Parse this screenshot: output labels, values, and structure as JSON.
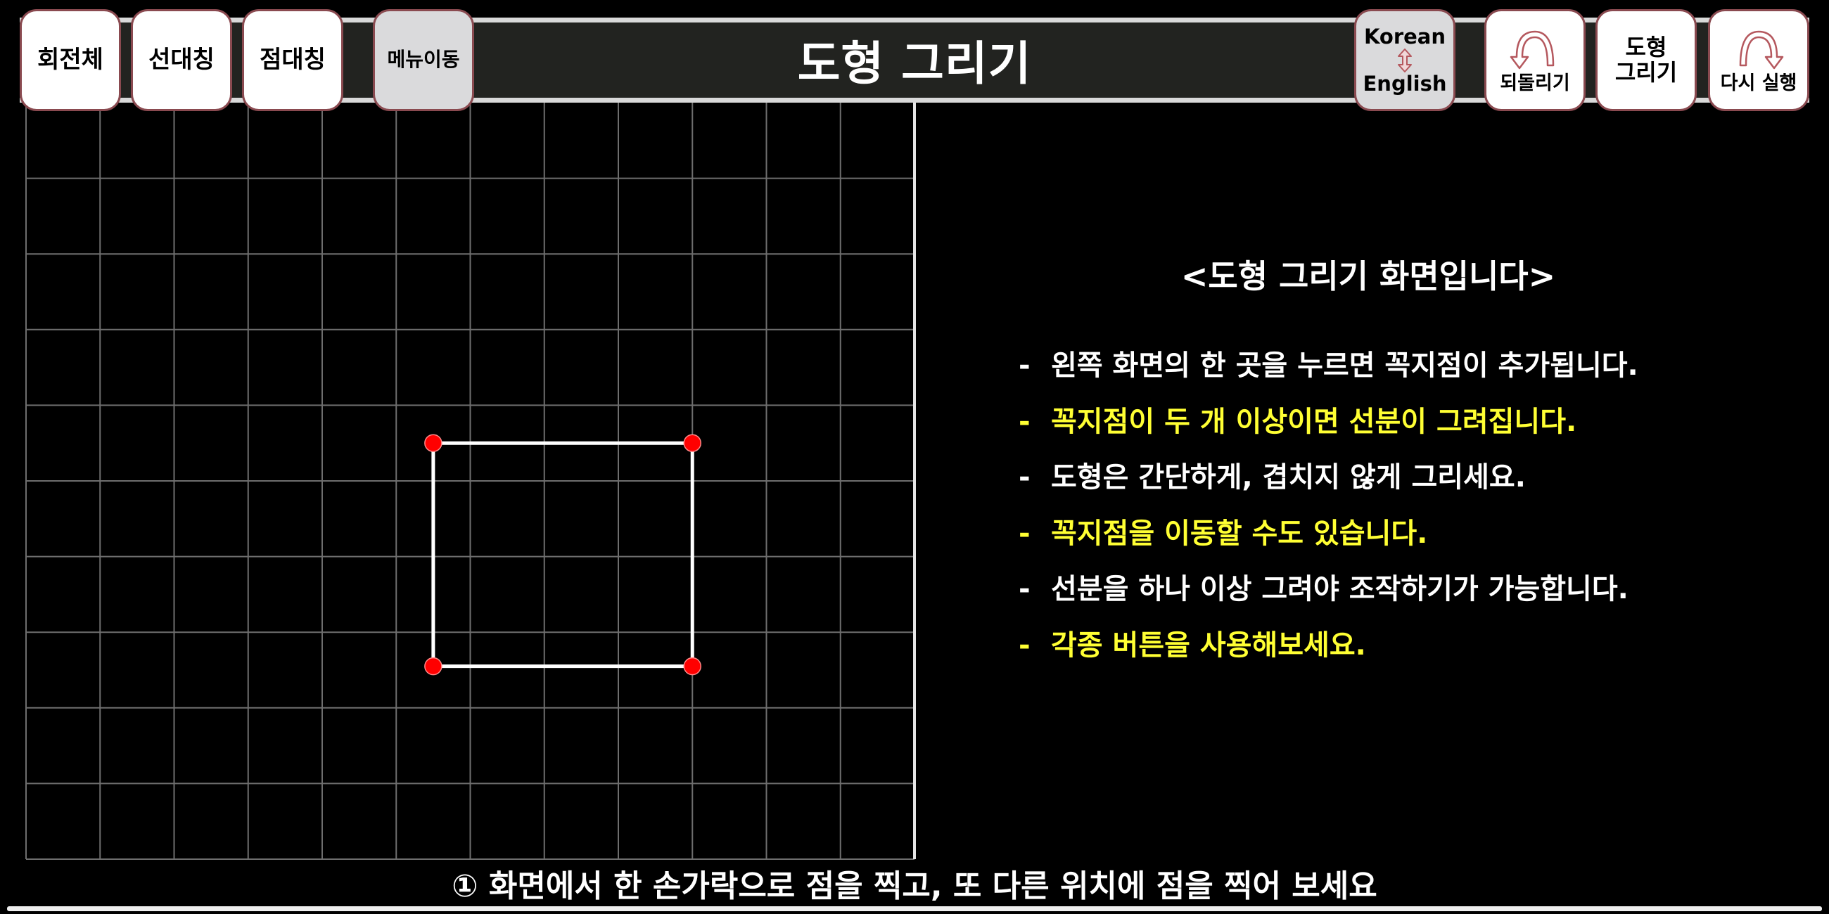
{
  "header": {
    "title": "도형 그리기",
    "left_buttons": [
      {
        "label": "회전체",
        "style": "white"
      },
      {
        "label": "선대칭",
        "style": "white"
      },
      {
        "label": "점대칭",
        "style": "white"
      },
      {
        "label": "메뉴이동",
        "style": "gray"
      }
    ],
    "language_toggle": {
      "top": "Korean",
      "bottom": "English",
      "icon": "up-down-arrow-icon"
    },
    "undo": {
      "label": "되돌리기",
      "icon": "undo-arc-arrow-icon"
    },
    "draw_shape": {
      "line1": "도형",
      "line2": "그리기"
    },
    "redo": {
      "label": "다시 실행",
      "icon": "redo-arc-arrow-icon"
    }
  },
  "colors": {
    "button_border": "#8a4a50",
    "arrow_icon": "#b5585e",
    "grid_line": "#6e6e6e",
    "shape_edge": "#ffffff",
    "vertex": "#ff0000",
    "highlight_text": "#ffff33"
  },
  "canvas": {
    "grid": {
      "columns": 12,
      "rows": 10
    },
    "shape": {
      "closed": true,
      "vertices": [
        {
          "gx": 5.5,
          "gy": 4.5
        },
        {
          "gx": 9.0,
          "gy": 4.5
        },
        {
          "gx": 9.0,
          "gy": 7.45
        },
        {
          "gx": 5.5,
          "gy": 7.45
        }
      ]
    }
  },
  "panel": {
    "title": "<도형 그리기 화면입니다>",
    "instructions": [
      {
        "text": "왼쪽 화면의 한 곳을 누르면 꼭지점이 추가됩니다.",
        "color": "white"
      },
      {
        "text": "꼭지점이 두 개 이상이면 선분이 그려집니다.",
        "color": "yellow"
      },
      {
        "text": "도형은 간단하게, 겹치지 않게 그리세요.",
        "color": "white"
      },
      {
        "text": "꼭지점을 이동할 수도 있습니다.",
        "color": "yellow"
      },
      {
        "text": "선분을 하나 이상 그려야 조작하기가 가능합니다.",
        "color": "white"
      },
      {
        "text": "각종 버튼을 사용해보세요.",
        "color": "yellow"
      }
    ],
    "bullet": "-"
  },
  "footer": {
    "hint": "① 화면에서 한 손가락으로 점을 찍고, 또 다른 위치에 점을 찍어 보세요"
  }
}
